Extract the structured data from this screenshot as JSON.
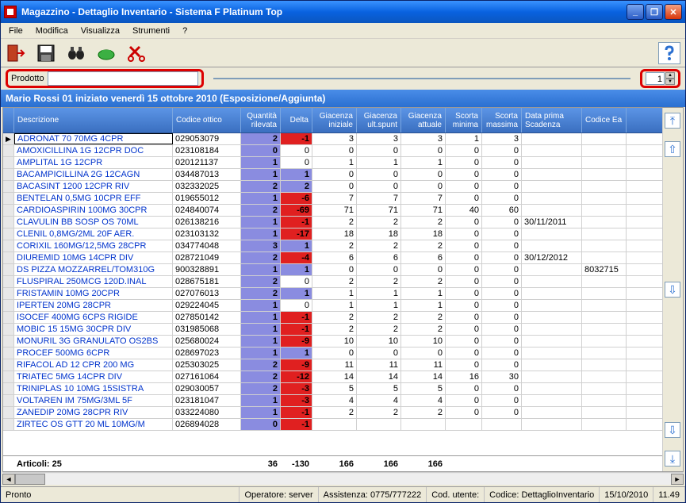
{
  "window": {
    "title": "Magazzino - Dettaglio Inventario - Sistema F Platinum Top"
  },
  "menus": {
    "file": "File",
    "modifica": "Modifica",
    "visualizza": "Visualizza",
    "strumenti": "Strumenti",
    "help": "?"
  },
  "search": {
    "label": "Prodotto",
    "value": "",
    "count": "1"
  },
  "bluebar": "Mario Rossi 01 iniziato venerdì 15 ottobre 2010 (Esposizione/Aggiunta)",
  "headers": {
    "desc": "Descrizione",
    "cod": "Codice ottico",
    "qr": "Quantità rilevata",
    "delta": "Delta",
    "gini": "Giacenza iniziale",
    "gus": "Giacenza ult.spunt",
    "gatt": "Giacenza attuale",
    "smin": "Scorta minima",
    "smax": "Scorta massima",
    "dps": "Data prima Scadenza",
    "cean": "Codice Ea"
  },
  "rows": [
    {
      "sel": true,
      "desc": "ADRONAT 70 70MG  4CPR",
      "cod": "029053079",
      "qr": "2",
      "delta": "-1",
      "gini": "3",
      "gus": "3",
      "gatt": "3",
      "smin": "1",
      "smax": "3",
      "dps": "",
      "cean": ""
    },
    {
      "desc": "AMOXICILLINA 1G 12CPR  DOC",
      "cod": "023108184",
      "qr": "0",
      "delta": "0",
      "gini": "0",
      "gus": "0",
      "gatt": "0",
      "smin": "0",
      "smax": "0",
      "dps": "",
      "cean": ""
    },
    {
      "desc": "AMPLITAL 1G 12CPR",
      "cod": "020121137",
      "qr": "1",
      "delta": "0",
      "gini": "1",
      "gus": "1",
      "gatt": "1",
      "smin": "0",
      "smax": "0",
      "dps": "",
      "cean": ""
    },
    {
      "desc": "BACAMPICILLINA 2G 12CAGN",
      "cod": "034487013",
      "qr": "1",
      "delta": "1",
      "gini": "0",
      "gus": "0",
      "gatt": "0",
      "smin": "0",
      "smax": "0",
      "dps": "",
      "cean": ""
    },
    {
      "desc": "BACASINT 1200 12CPR RIV",
      "cod": "032332025",
      "qr": "2",
      "delta": "2",
      "gini": "0",
      "gus": "0",
      "gatt": "0",
      "smin": "0",
      "smax": "0",
      "dps": "",
      "cean": ""
    },
    {
      "desc": "BENTELAN 0,5MG 10CPR EFF",
      "cod": "019655012",
      "qr": "1",
      "delta": "-6",
      "gini": "7",
      "gus": "7",
      "gatt": "7",
      "smin": "0",
      "smax": "0",
      "dps": "",
      "cean": ""
    },
    {
      "desc": "CARDIOASPIRIN 100MG 30CPR",
      "cod": "024840074",
      "qr": "2",
      "delta": "-69",
      "gini": "71",
      "gus": "71",
      "gatt": "71",
      "smin": "40",
      "smax": "60",
      "dps": "",
      "cean": ""
    },
    {
      "desc": "CLAVULIN BB SOSP OS   70ML",
      "cod": "026138216",
      "qr": "1",
      "delta": "-1",
      "gini": "2",
      "gus": "2",
      "gatt": "2",
      "smin": "0",
      "smax": "0",
      "dps": "30/11/2011",
      "cean": ""
    },
    {
      "desc": "CLENIL 0,8MG/2ML 20F AER.",
      "cod": "023103132",
      "qr": "1",
      "delta": "-17",
      "gini": "18",
      "gus": "18",
      "gatt": "18",
      "smin": "0",
      "smax": "0",
      "dps": "",
      "cean": ""
    },
    {
      "desc": "CORIXIL 160MG/12,5MG 28CPR",
      "cod": "034774048",
      "qr": "3",
      "delta": "1",
      "gini": "2",
      "gus": "2",
      "gatt": "2",
      "smin": "0",
      "smax": "0",
      "dps": "",
      "cean": ""
    },
    {
      "desc": "DIUREMID 10MG 14CPR DIV",
      "cod": "028721049",
      "qr": "2",
      "delta": "-4",
      "gini": "6",
      "gus": "6",
      "gatt": "6",
      "smin": "0",
      "smax": "0",
      "dps": "30/12/2012",
      "cean": ""
    },
    {
      "desc": "DS PIZZA MOZZARREL/TOM310G",
      "cod": "900328891",
      "qr": "1",
      "delta": "1",
      "gini": "0",
      "gus": "0",
      "gatt": "0",
      "smin": "0",
      "smax": "0",
      "dps": "",
      "cean": "8032715"
    },
    {
      "desc": "FLUSPIRAL 250MCG 120D.INAL",
      "cod": "028675181",
      "qr": "2",
      "delta": "0",
      "gini": "2",
      "gus": "2",
      "gatt": "2",
      "smin": "0",
      "smax": "0",
      "dps": "",
      "cean": ""
    },
    {
      "desc": "FRISTAMIN 10MG 20CPR",
      "cod": "027076013",
      "qr": "2",
      "delta": "1",
      "gini": "1",
      "gus": "1",
      "gatt": "1",
      "smin": "0",
      "smax": "0",
      "dps": "",
      "cean": ""
    },
    {
      "desc": "IPERTEN 20MG 28CPR",
      "cod": "029224045",
      "qr": "1",
      "delta": "0",
      "gini": "1",
      "gus": "1",
      "gatt": "1",
      "smin": "0",
      "smax": "0",
      "dps": "",
      "cean": ""
    },
    {
      "desc": "ISOCEF 400MG 6CPS RIGIDE",
      "cod": "027850142",
      "qr": "1",
      "delta": "-1",
      "gini": "2",
      "gus": "2",
      "gatt": "2",
      "smin": "0",
      "smax": "0",
      "dps": "",
      "cean": ""
    },
    {
      "desc": "MOBIC 15 15MG 30CPR DIV",
      "cod": "031985068",
      "qr": "1",
      "delta": "-1",
      "gini": "2",
      "gus": "2",
      "gatt": "2",
      "smin": "0",
      "smax": "0",
      "dps": "",
      "cean": ""
    },
    {
      "desc": "MONURIL 3G GRANULATO OS2BS",
      "cod": "025680024",
      "qr": "1",
      "delta": "-9",
      "gini": "10",
      "gus": "10",
      "gatt": "10",
      "smin": "0",
      "smax": "0",
      "dps": "",
      "cean": ""
    },
    {
      "desc": "PROCEF 500MG 6CPR",
      "cod": "028697023",
      "qr": "1",
      "delta": "1",
      "gini": "0",
      "gus": "0",
      "gatt": "0",
      "smin": "0",
      "smax": "0",
      "dps": "",
      "cean": ""
    },
    {
      "desc": "RIFACOL AD 12 CPR 200 MG",
      "cod": "025303025",
      "qr": "2",
      "delta": "-9",
      "gini": "11",
      "gus": "11",
      "gatt": "11",
      "smin": "0",
      "smax": "0",
      "dps": "",
      "cean": ""
    },
    {
      "desc": "TRIATEC  5MG  14CPR DIV",
      "cod": "027161064",
      "qr": "2",
      "delta": "-12",
      "gini": "14",
      "gus": "14",
      "gatt": "14",
      "smin": "16",
      "smax": "30",
      "dps": "",
      "cean": ""
    },
    {
      "desc": "TRINIPLAS 10 10MG 15SISTRA",
      "cod": "029030057",
      "qr": "2",
      "delta": "-3",
      "gini": "5",
      "gus": "5",
      "gatt": "5",
      "smin": "0",
      "smax": "0",
      "dps": "",
      "cean": ""
    },
    {
      "desc": "VOLTAREN IM 75MG/3ML   5F",
      "cod": "023181047",
      "qr": "1",
      "delta": "-3",
      "gini": "4",
      "gus": "4",
      "gatt": "4",
      "smin": "0",
      "smax": "0",
      "dps": "",
      "cean": ""
    },
    {
      "desc": "ZANEDIP 20MG 28CPR RIV",
      "cod": "033224080",
      "qr": "1",
      "delta": "-1",
      "gini": "2",
      "gus": "2",
      "gatt": "2",
      "smin": "0",
      "smax": "0",
      "dps": "",
      "cean": ""
    },
    {
      "desc": "ZIRTEC OS GTT 20 ML 10MG/M",
      "cod": "026894028",
      "qr": "0",
      "delta": "-1",
      "gini": "",
      "gus": "",
      "gatt": "",
      "smin": "",
      "smax": "",
      "dps": "",
      "cean": ""
    }
  ],
  "footer": {
    "label": "Articoli: 25",
    "qr": "36",
    "delta": "-130",
    "gini": "166",
    "gus": "166",
    "gatt": "166"
  },
  "status": {
    "ready": "Pronto",
    "op": "Operatore: server",
    "ass": "Assistenza: 0775/777222",
    "cu": "Cod. utente:",
    "cod": "Codice: DettaglioInventario",
    "date": "15/10/2010",
    "time": "11.49"
  }
}
